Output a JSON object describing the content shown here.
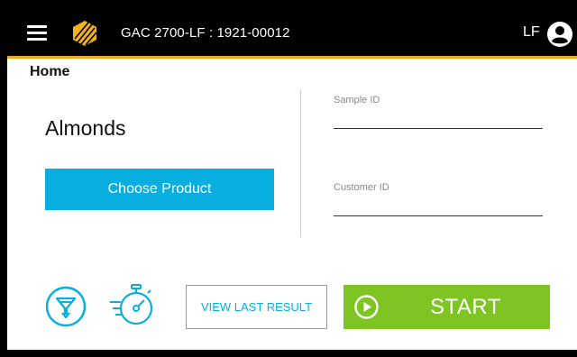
{
  "header": {
    "menu_icon": "hamburger-menu-icon",
    "logo_icon": "brand-logo",
    "title": "GAC 2700-LF : 1921-00012",
    "user_initials": "LF",
    "account_icon": "account-circle-icon",
    "accent_color": "#f2a71d"
  },
  "page": {
    "breadcrumb": "Home"
  },
  "product": {
    "name": "Almonds",
    "choose_button_label": "Choose Product",
    "button_color": "#08aee0"
  },
  "form": {
    "sample_id": {
      "label": "Sample ID",
      "value": ""
    },
    "customer_id": {
      "label": "Customer ID",
      "value": ""
    }
  },
  "actions": {
    "filter_icon": "filter-funnel-icon",
    "timer_icon": "stopwatch-timer-icon",
    "view_last_result_label": "VIEW LAST RESULT",
    "start_label": "START",
    "start_icon": "play-circle-icon",
    "start_color": "#7ec423"
  }
}
